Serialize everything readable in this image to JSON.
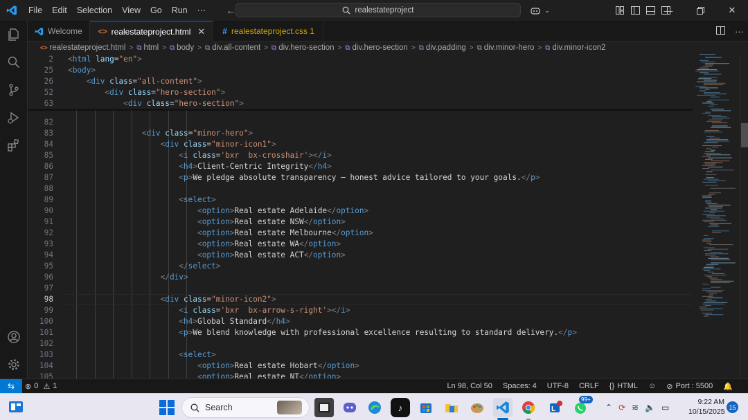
{
  "menu": [
    "File",
    "Edit",
    "Selection",
    "View",
    "Go",
    "Run",
    "···"
  ],
  "command_center": {
    "placeholder": "realestateproject"
  },
  "tabs": [
    {
      "label": "Welcome",
      "active": false
    },
    {
      "label": "realestateproject.html",
      "active": true
    },
    {
      "label": "realestateproject.css 1",
      "active": false
    }
  ],
  "breadcrumb": [
    "realestateproject.html",
    "html",
    "body",
    "div.all-content",
    "div.hero-section",
    "div.hero-section",
    "div.padding",
    "div.minor-hero",
    "div.minor-icon2"
  ],
  "editor": {
    "sticky_lines": [
      {
        "num": "2",
        "code": "<html lang=\"en\">"
      },
      {
        "num": "25",
        "code": "<body>"
      },
      {
        "num": "26",
        "code": "    <div class=\"all-content\">"
      },
      {
        "num": "52",
        "code": "        <div class=\"hero-section\">"
      },
      {
        "num": "63",
        "code": "            <div class=\"hero-section\">"
      }
    ],
    "current_line": "98",
    "lines": [
      {
        "num": "82",
        "code": ""
      },
      {
        "num": "83",
        "code": "                <div class=\"minor-hero\">"
      },
      {
        "num": "84",
        "code": "                    <div class=\"minor-icon1\">"
      },
      {
        "num": "85",
        "code": "                        <i class='bxr  bx-crosshair'></i>"
      },
      {
        "num": "86",
        "code": "                        <h4>Client-Centric Integrity</h4>"
      },
      {
        "num": "87",
        "code": "                        <p>We pledge absolute transparency — honest advice tailored to your goals.</p>"
      },
      {
        "num": "88",
        "code": ""
      },
      {
        "num": "89",
        "code": "                        <select>"
      },
      {
        "num": "90",
        "code": "                            <option>Real estate Adelaide</option>"
      },
      {
        "num": "91",
        "code": "                            <option>Real estate NSW</option>"
      },
      {
        "num": "92",
        "code": "                            <option>Real estate Melbourne</option>"
      },
      {
        "num": "93",
        "code": "                            <option>Real estate WA</option>"
      },
      {
        "num": "94",
        "code": "                            <option>Real estate ACT</option>"
      },
      {
        "num": "95",
        "code": "                        </select>"
      },
      {
        "num": "96",
        "code": "                    </div>"
      },
      {
        "num": "97",
        "code": ""
      },
      {
        "num": "98",
        "code": "                    <div class=\"minor-icon2\">"
      },
      {
        "num": "99",
        "code": "                        <i class='bxr  bx-arrow-s-right'></i>"
      },
      {
        "num": "100",
        "code": "                        <h4>Global Standard</h4>"
      },
      {
        "num": "101",
        "code": "                        <p>We blend knowledge with professional excellence resulting to standard delivery.</p>"
      },
      {
        "num": "102",
        "code": ""
      },
      {
        "num": "103",
        "code": "                        <select>"
      },
      {
        "num": "104",
        "code": "                            <option>Real estate Hobart</option>"
      },
      {
        "num": "105",
        "code": "                            <option>Real estate NT</option>"
      }
    ]
  },
  "statusbar": {
    "errors": "0",
    "warnings": "1",
    "cursor": "Ln 98, Col 50",
    "spaces": "Spaces: 4",
    "encoding": "UTF-8",
    "eol": "CRLF",
    "language": "HTML",
    "port": "Port : 5500"
  },
  "taskbar": {
    "search_label": "Search",
    "badge_count": "99+",
    "time": "9:22 AM",
    "date": "10/15/2025",
    "notification_count": "15"
  },
  "colors": {
    "accent": "#0078d4",
    "tag": "#569cd6",
    "attribute": "#9cdcfe",
    "string": "#ce9178"
  }
}
